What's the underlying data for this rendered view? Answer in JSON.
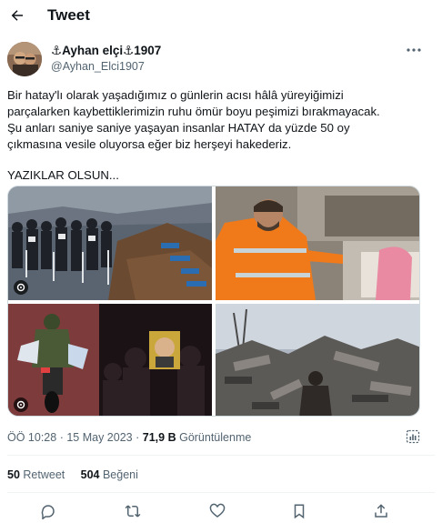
{
  "header": {
    "title": "Tweet",
    "back_icon": "arrow-left-icon"
  },
  "author": {
    "display_name": "⚓Ayhan elçi⚓1907",
    "handle": "@Ayhan_Elci1907",
    "avatar_icon": "avatar"
  },
  "tweet": {
    "lines": [
      "Bir hatay'lı olarak yaşadığımız o günlerin acısı hâlâ yüreyiğimizi",
      "parçalarken kaybettiklerimizin ruhu ömür boyu peşimizi bırakmayacak.",
      "Şu anları saniye saniye yaşayan insanlar HATAY da yüzde 50 oy",
      "çıkmasına vesile oluyorsa eğer biz herşeyi hakederiz."
    ],
    "closing": "YAZIKLAR OLSUN..."
  },
  "media": [
    {
      "name": "photo-crowd-graves",
      "gif": true
    },
    {
      "name": "photo-rescue-worker",
      "gif": false
    },
    {
      "name": "photo-motorcycle-poster",
      "gif": true
    },
    {
      "name": "photo-rubble-man",
      "gif": false
    }
  ],
  "meta": {
    "time": "ÖÖ 10:28",
    "separator": "·",
    "date": "15 May 2023",
    "views_count": "71,9 B",
    "views_label": "Görüntülenme"
  },
  "stats": {
    "retweets_count": "50",
    "retweets_label": "Retweet",
    "likes_count": "504",
    "likes_label": "Beğeni"
  },
  "actions": [
    "reply-icon",
    "retweet-icon",
    "like-icon",
    "bookmark-icon",
    "share-icon"
  ],
  "colors": {
    "text": "#0f1419",
    "secondary": "#536471",
    "border": "#eff3f4",
    "rescue_orange": "#f07a1a"
  }
}
